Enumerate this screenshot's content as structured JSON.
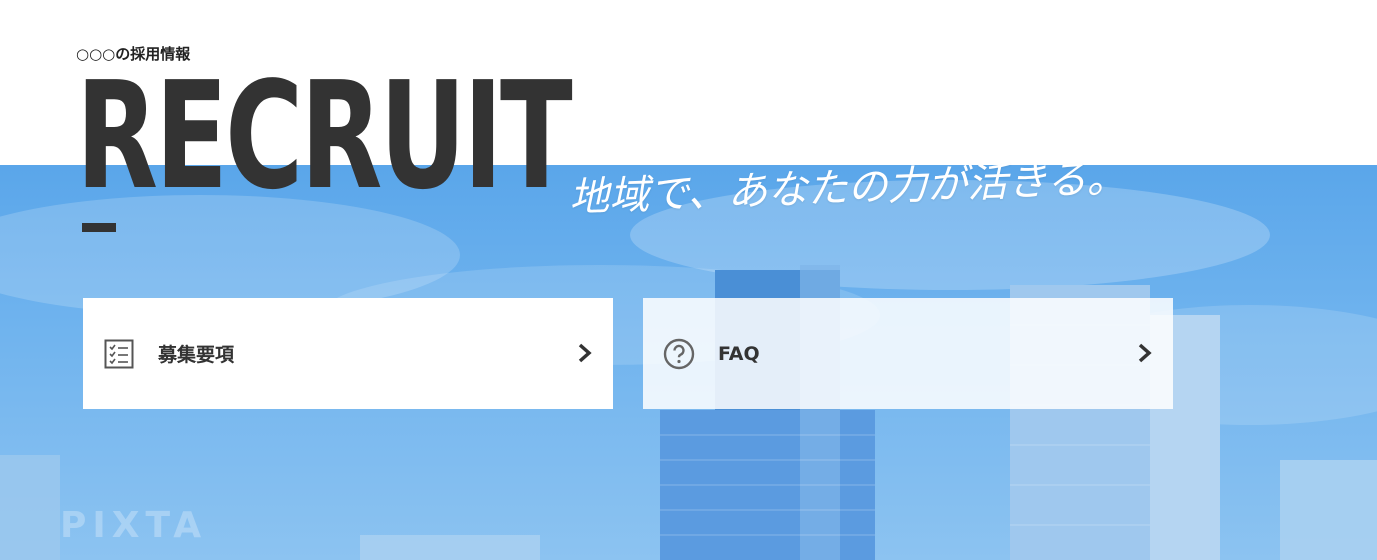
{
  "header": {
    "subtitle": "○○○の採用情報",
    "title": "RECRUIT",
    "tagline": "地域で、あなたの力が活きる。"
  },
  "cards": [
    {
      "label": "募集要項",
      "icon": "checklist-icon"
    },
    {
      "label": "FAQ",
      "icon": "question-circle-icon"
    }
  ],
  "watermark": "PIXTA",
  "colors": {
    "title": "#333333",
    "sky": "#6fb3ee",
    "card_bg": "#ffffff"
  }
}
